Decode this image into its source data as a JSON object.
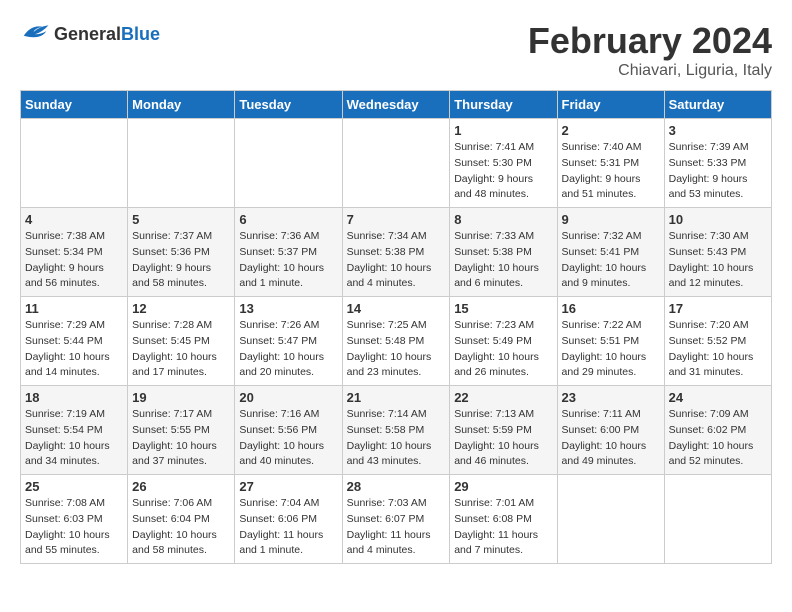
{
  "header": {
    "logo": {
      "general": "General",
      "blue": "Blue"
    },
    "title": "February 2024",
    "subtitle": "Chiavari, Liguria, Italy"
  },
  "calendar": {
    "columns": [
      "Sunday",
      "Monday",
      "Tuesday",
      "Wednesday",
      "Thursday",
      "Friday",
      "Saturday"
    ],
    "rows": [
      [
        {
          "day": "",
          "info": ""
        },
        {
          "day": "",
          "info": ""
        },
        {
          "day": "",
          "info": ""
        },
        {
          "day": "",
          "info": ""
        },
        {
          "day": "1",
          "info": "Sunrise: 7:41 AM\nSunset: 5:30 PM\nDaylight: 9 hours\nand 48 minutes."
        },
        {
          "day": "2",
          "info": "Sunrise: 7:40 AM\nSunset: 5:31 PM\nDaylight: 9 hours\nand 51 minutes."
        },
        {
          "day": "3",
          "info": "Sunrise: 7:39 AM\nSunset: 5:33 PM\nDaylight: 9 hours\nand 53 minutes."
        }
      ],
      [
        {
          "day": "4",
          "info": "Sunrise: 7:38 AM\nSunset: 5:34 PM\nDaylight: 9 hours\nand 56 minutes."
        },
        {
          "day": "5",
          "info": "Sunrise: 7:37 AM\nSunset: 5:36 PM\nDaylight: 9 hours\nand 58 minutes."
        },
        {
          "day": "6",
          "info": "Sunrise: 7:36 AM\nSunset: 5:37 PM\nDaylight: 10 hours\nand 1 minute."
        },
        {
          "day": "7",
          "info": "Sunrise: 7:34 AM\nSunset: 5:38 PM\nDaylight: 10 hours\nand 4 minutes."
        },
        {
          "day": "8",
          "info": "Sunrise: 7:33 AM\nSunset: 5:38 PM\nDaylight: 10 hours\nand 6 minutes."
        },
        {
          "day": "9",
          "info": "Sunrise: 7:32 AM\nSunset: 5:41 PM\nDaylight: 10 hours\nand 9 minutes."
        },
        {
          "day": "10",
          "info": "Sunrise: 7:30 AM\nSunset: 5:43 PM\nDaylight: 10 hours\nand 12 minutes."
        }
      ],
      [
        {
          "day": "11",
          "info": "Sunrise: 7:29 AM\nSunset: 5:44 PM\nDaylight: 10 hours\nand 14 minutes."
        },
        {
          "day": "12",
          "info": "Sunrise: 7:28 AM\nSunset: 5:45 PM\nDaylight: 10 hours\nand 17 minutes."
        },
        {
          "day": "13",
          "info": "Sunrise: 7:26 AM\nSunset: 5:47 PM\nDaylight: 10 hours\nand 20 minutes."
        },
        {
          "day": "14",
          "info": "Sunrise: 7:25 AM\nSunset: 5:48 PM\nDaylight: 10 hours\nand 23 minutes."
        },
        {
          "day": "15",
          "info": "Sunrise: 7:23 AM\nSunset: 5:49 PM\nDaylight: 10 hours\nand 26 minutes."
        },
        {
          "day": "16",
          "info": "Sunrise: 7:22 AM\nSunset: 5:51 PM\nDaylight: 10 hours\nand 29 minutes."
        },
        {
          "day": "17",
          "info": "Sunrise: 7:20 AM\nSunset: 5:52 PM\nDaylight: 10 hours\nand 31 minutes."
        }
      ],
      [
        {
          "day": "18",
          "info": "Sunrise: 7:19 AM\nSunset: 5:54 PM\nDaylight: 10 hours\nand 34 minutes."
        },
        {
          "day": "19",
          "info": "Sunrise: 7:17 AM\nSunset: 5:55 PM\nDaylight: 10 hours\nand 37 minutes."
        },
        {
          "day": "20",
          "info": "Sunrise: 7:16 AM\nSunset: 5:56 PM\nDaylight: 10 hours\nand 40 minutes."
        },
        {
          "day": "21",
          "info": "Sunrise: 7:14 AM\nSunset: 5:58 PM\nDaylight: 10 hours\nand 43 minutes."
        },
        {
          "day": "22",
          "info": "Sunrise: 7:13 AM\nSunset: 5:59 PM\nDaylight: 10 hours\nand 46 minutes."
        },
        {
          "day": "23",
          "info": "Sunrise: 7:11 AM\nSunset: 6:00 PM\nDaylight: 10 hours\nand 49 minutes."
        },
        {
          "day": "24",
          "info": "Sunrise: 7:09 AM\nSunset: 6:02 PM\nDaylight: 10 hours\nand 52 minutes."
        }
      ],
      [
        {
          "day": "25",
          "info": "Sunrise: 7:08 AM\nSunset: 6:03 PM\nDaylight: 10 hours\nand 55 minutes."
        },
        {
          "day": "26",
          "info": "Sunrise: 7:06 AM\nSunset: 6:04 PM\nDaylight: 10 hours\nand 58 minutes."
        },
        {
          "day": "27",
          "info": "Sunrise: 7:04 AM\nSunset: 6:06 PM\nDaylight: 11 hours\nand 1 minute."
        },
        {
          "day": "28",
          "info": "Sunrise: 7:03 AM\nSunset: 6:07 PM\nDaylight: 11 hours\nand 4 minutes."
        },
        {
          "day": "29",
          "info": "Sunrise: 7:01 AM\nSunset: 6:08 PM\nDaylight: 11 hours\nand 7 minutes."
        },
        {
          "day": "",
          "info": ""
        },
        {
          "day": "",
          "info": ""
        }
      ]
    ]
  }
}
